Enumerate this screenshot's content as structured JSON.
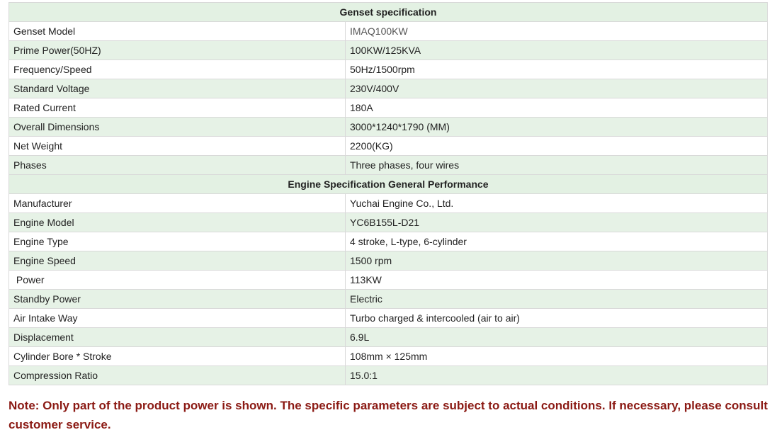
{
  "genset": {
    "title": "Genset specification",
    "rows": [
      {
        "label": "Genset Model",
        "value": "IMAQ100KW"
      },
      {
        "label": "Prime Power(50HZ)",
        "value": "100KW/125KVA"
      },
      {
        "label": "Frequency/Speed",
        "value": "50Hz/1500rpm"
      },
      {
        "label": "Standard Voltage",
        "value": "230V/400V"
      },
      {
        "label": "Rated Current",
        "value": "180A"
      },
      {
        "label": "Overall Dimensions",
        "value": "3000*1240*1790 (MM)"
      },
      {
        "label": "Net Weight",
        "value": "2200(KG)"
      },
      {
        "label": "Phases",
        "value": "Three phases, four wires"
      }
    ]
  },
  "engine": {
    "title": "Engine Specification General Performance",
    "rows": [
      {
        "label": "Manufacturer",
        "value": "Yuchai Engine Co., Ltd."
      },
      {
        "label": "Engine Model",
        "value": "YC6B155L-D21"
      },
      {
        "label": "Engine Type",
        "value": "4 stroke, L-type, 6-cylinder"
      },
      {
        "label": "Engine Speed",
        "value": "1500 rpm"
      },
      {
        "label": " Power",
        "value": "113KW"
      },
      {
        "label": "Standby Power",
        "value": "Electric"
      },
      {
        "label": "Air Intake Way",
        "value": "Turbo charged & intercooled (air to air)"
      },
      {
        "label": "Displacement",
        "value": "6.9L"
      },
      {
        "label": "Cylinder Bore * Stroke",
        "value": "108mm × 125mm"
      },
      {
        "label": "Compression Ratio",
        "value": "15.0:1"
      }
    ]
  },
  "note": "Note: Only part of the product power is shown. The specific parameters are subject to actual conditions. If necessary, please consult customer service.",
  "colors": {
    "header_bg": "#e3f1e3",
    "alt_row_bg": "#e6f2e6",
    "note_text": "#8b1a14"
  }
}
